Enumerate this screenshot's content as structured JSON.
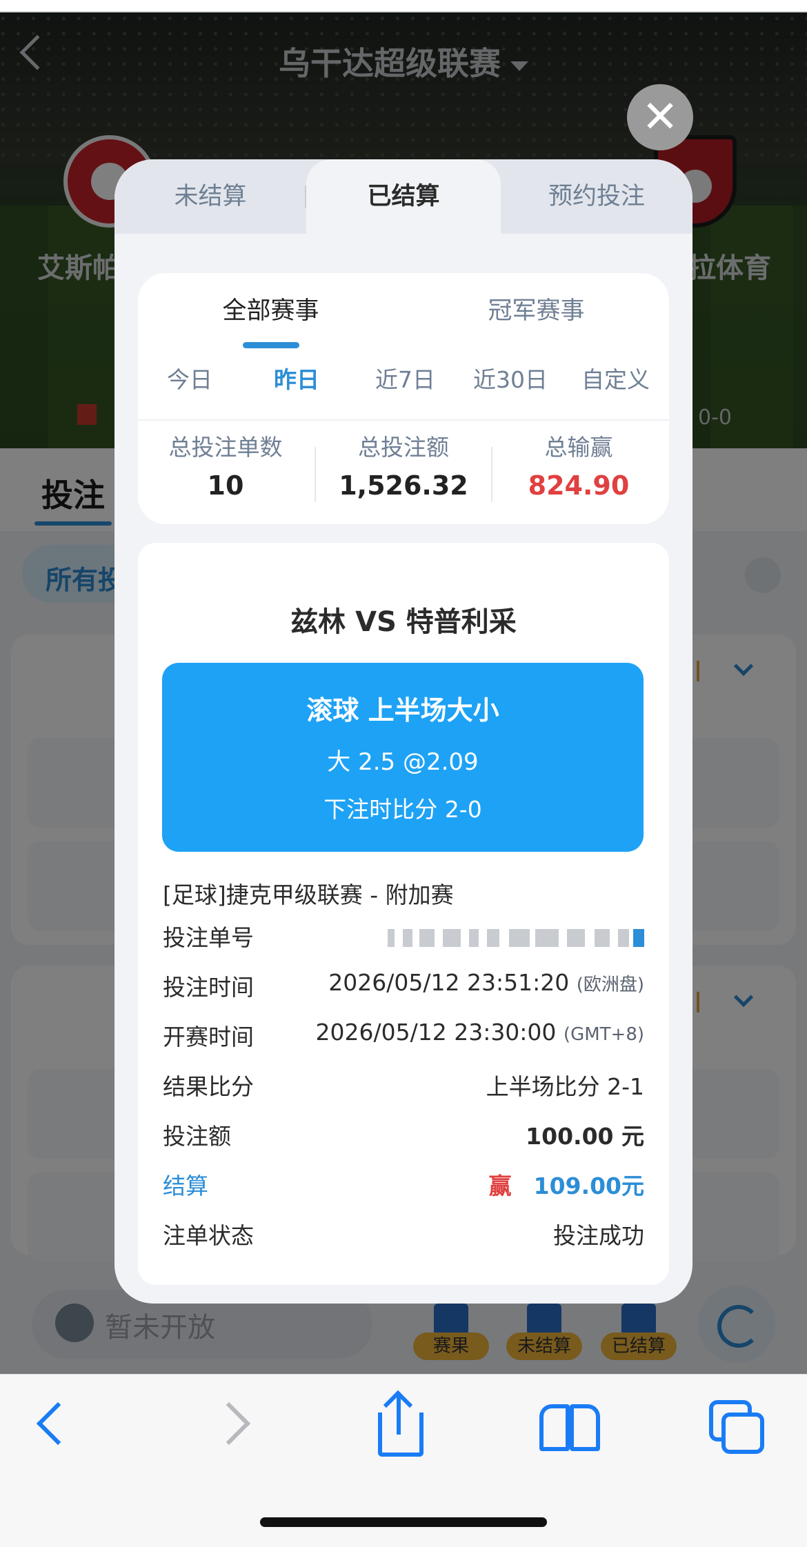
{
  "hero": {
    "title": "乌干达超级联赛",
    "home_team_partial": "艾斯帕",
    "away_team_partial": "拉体育",
    "score": "0-0"
  },
  "background": {
    "tab_label": "投注",
    "filter_chip": "所有投",
    "chat_placeholder": "暂未开放",
    "bottom_buttons": [
      "赛果",
      "未结算",
      "已结算"
    ]
  },
  "modal": {
    "tabs": [
      "未结算",
      "已结算",
      "预约投注"
    ],
    "active_tab": "已结算",
    "sub_tabs": [
      "全部赛事",
      "冠军赛事"
    ],
    "date_filters": [
      "今日",
      "昨日",
      "近7日",
      "近30日",
      "自定义"
    ],
    "active_date_filter": "昨日",
    "summary": {
      "count_label": "总投注单数",
      "count_value": "10",
      "amount_label": "总投注额",
      "amount_value": "1,526.32",
      "winloss_label": "总输赢",
      "winloss_value": "824.90"
    },
    "bet": {
      "match": "兹林  VS  特普利采",
      "bet_type": "滚球 上半场大小",
      "selection": "大 2.5    @2.09",
      "score_at_bet": "下注时比分 2-0",
      "league": "[足球]捷克甲级联赛 - 附加赛",
      "rows": {
        "bet_no_label": "投注单号",
        "bet_time_label": "投注时间",
        "bet_time_value": "2026/05/12 23:51:20",
        "bet_time_note": "(欧洲盘)",
        "start_time_label": "开赛时间",
        "start_time_value": "2026/05/12 23:30:00",
        "start_time_note": "(GMT+8)",
        "result_label": "结果比分",
        "result_value": "上半场比分 2-1",
        "stake_label": "投注额",
        "stake_value": "100.00 元",
        "settle_label": "结算",
        "settle_outcome": "赢",
        "settle_value": "109.00元",
        "status_label": "注单状态",
        "status_value": "投注成功"
      }
    }
  },
  "colors": {
    "accent_blue": "#2c8ed6",
    "bet_box_blue": "#1ea2f5",
    "win_red": "#e04040",
    "ios_blue": "#1a7cf5"
  }
}
